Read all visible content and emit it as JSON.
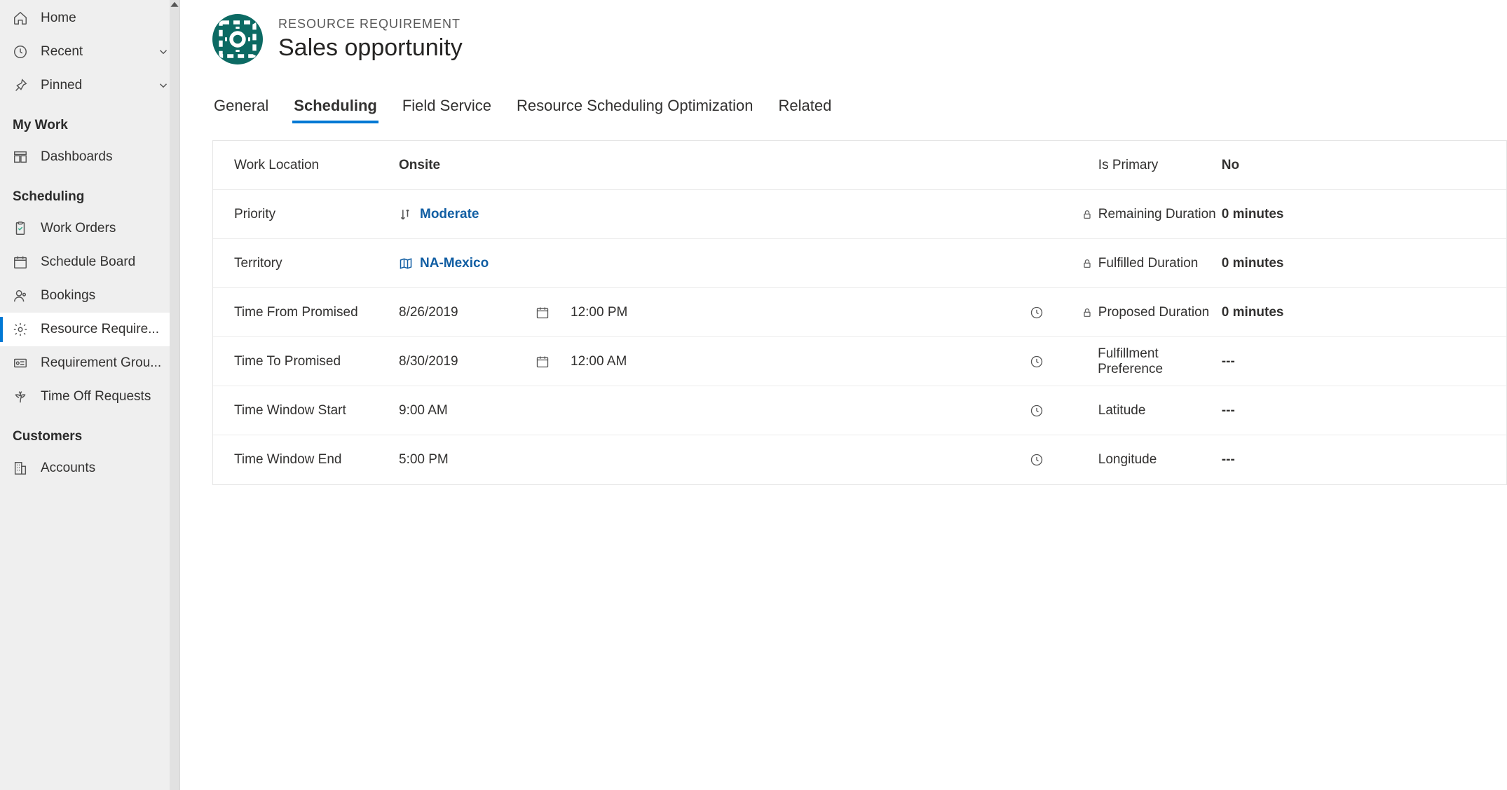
{
  "sidebar": {
    "top": [
      {
        "label": "Home",
        "icon": "home"
      },
      {
        "label": "Recent",
        "icon": "clock",
        "expandable": true
      },
      {
        "label": "Pinned",
        "icon": "pin",
        "expandable": true
      }
    ],
    "sections": [
      {
        "title": "My Work",
        "items": [
          {
            "label": "Dashboards",
            "icon": "dashboard"
          }
        ]
      },
      {
        "title": "Scheduling",
        "items": [
          {
            "label": "Work Orders",
            "icon": "clipboard"
          },
          {
            "label": "Schedule Board",
            "icon": "calendar"
          },
          {
            "label": "Bookings",
            "icon": "person"
          },
          {
            "label": "Resource Require...",
            "icon": "gear",
            "active": true
          },
          {
            "label": "Requirement Grou...",
            "icon": "card"
          },
          {
            "label": "Time Off Requests",
            "icon": "palm"
          }
        ]
      },
      {
        "title": "Customers",
        "items": [
          {
            "label": "Accounts",
            "icon": "building"
          }
        ]
      }
    ]
  },
  "header": {
    "subtitle": "RESOURCE REQUIREMENT",
    "title": "Sales opportunity"
  },
  "tabs": [
    {
      "label": "General"
    },
    {
      "label": "Scheduling",
      "active": true
    },
    {
      "label": "Field Service"
    },
    {
      "label": "Resource Scheduling Optimization"
    },
    {
      "label": "Related"
    }
  ],
  "fields_left": [
    {
      "label": "Work Location",
      "value": "Onsite",
      "type": "text",
      "bold": true
    },
    {
      "label": "Priority",
      "value": "Moderate",
      "type": "lookup",
      "icon": "sort"
    },
    {
      "label": "Territory",
      "value": "NA-Mexico",
      "type": "lookup",
      "icon": "map"
    },
    {
      "label": "Time From Promised",
      "date": "8/26/2019",
      "time": "12:00 PM",
      "type": "datetime"
    },
    {
      "label": "Time To Promised",
      "date": "8/30/2019",
      "time": "12:00 AM",
      "type": "datetime"
    },
    {
      "label": "Time Window Start",
      "time": "9:00 AM",
      "type": "time"
    },
    {
      "label": "Time Window End",
      "time": "5:00 PM",
      "type": "time"
    }
  ],
  "fields_right": [
    {
      "label": "Is Primary",
      "value": "No"
    },
    {
      "label": "Remaining Duration",
      "value": "0 minutes",
      "locked": true
    },
    {
      "label": "Fulfilled Duration",
      "value": "0 minutes",
      "locked": true
    },
    {
      "label": "Proposed Duration",
      "value": "0 minutes",
      "locked": true
    },
    {
      "label": "Fulfillment Preference",
      "value": "---"
    },
    {
      "label": "Latitude",
      "value": "---"
    },
    {
      "label": "Longitude",
      "value": "---"
    }
  ]
}
